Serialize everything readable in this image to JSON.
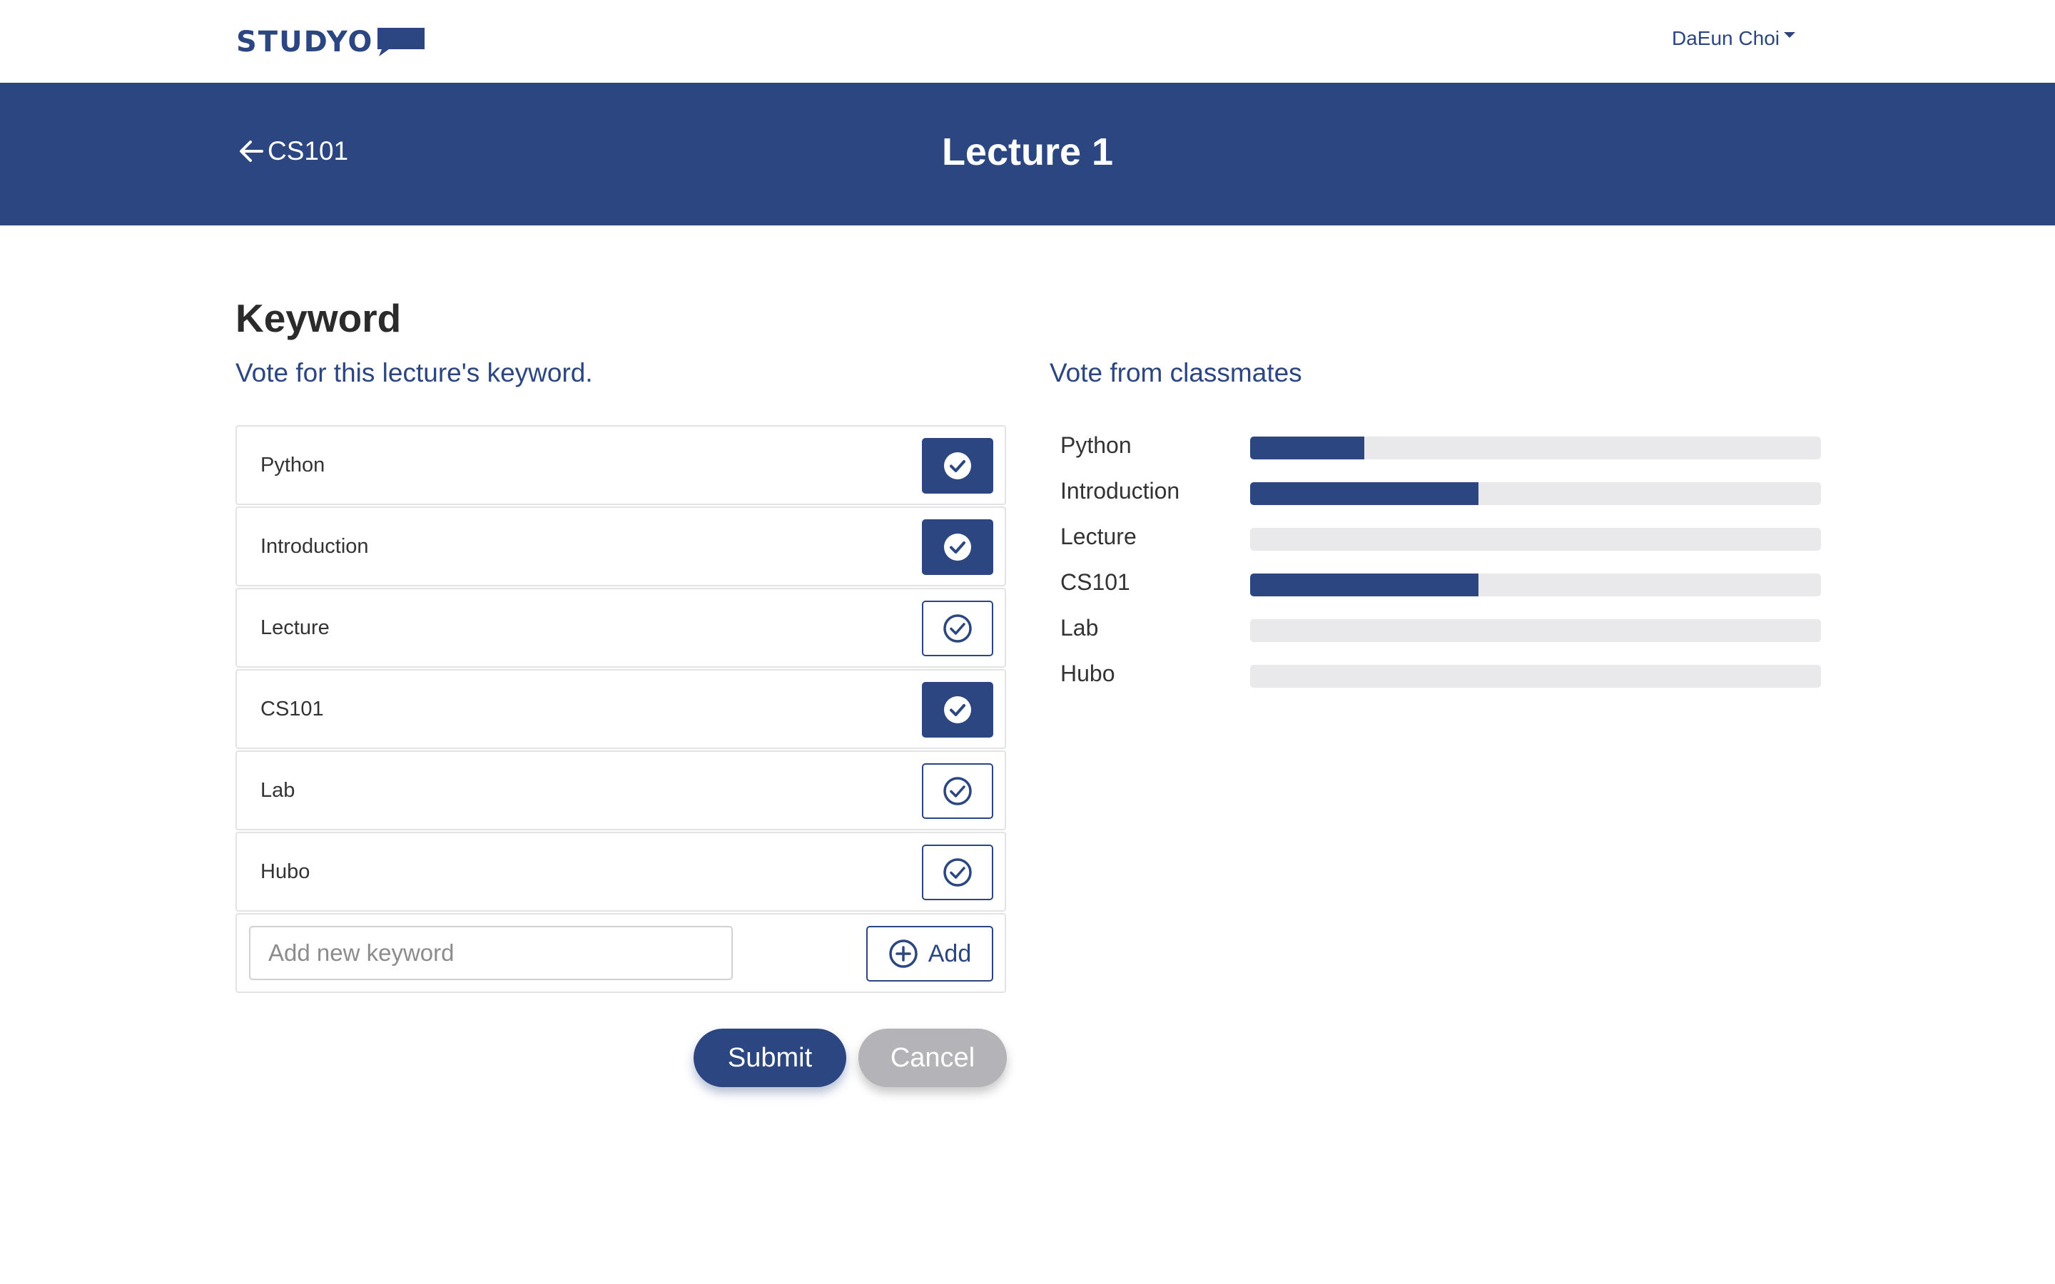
{
  "brand": {
    "logo_text": "STUDYO",
    "primary_color": "#2b4680"
  },
  "user": {
    "name": "DaEun Choi"
  },
  "banner": {
    "back_label": "CS101",
    "title": "Lecture 1"
  },
  "keyword_section": {
    "title": "Keyword",
    "subtitle": "Vote for this lecture's keyword.",
    "items": [
      {
        "label": "Python",
        "checked": true
      },
      {
        "label": "Introduction",
        "checked": true
      },
      {
        "label": "Lecture",
        "checked": false
      },
      {
        "label": "CS101",
        "checked": true
      },
      {
        "label": "Lab",
        "checked": false
      },
      {
        "label": "Hubo",
        "checked": false
      }
    ],
    "new_keyword_placeholder": "Add new keyword",
    "new_keyword_value": "",
    "add_label": "Add",
    "submit_label": "Submit",
    "cancel_label": "Cancel"
  },
  "classmates_section": {
    "title": "Vote from classmates",
    "votes": [
      {
        "label": "Python",
        "fraction": 0.2
      },
      {
        "label": "Introduction",
        "fraction": 0.4
      },
      {
        "label": "Lecture",
        "fraction": 0.0
      },
      {
        "label": "CS101",
        "fraction": 0.4
      },
      {
        "label": "Lab",
        "fraction": 0.0
      },
      {
        "label": "Hubo",
        "fraction": 0.0
      }
    ]
  }
}
